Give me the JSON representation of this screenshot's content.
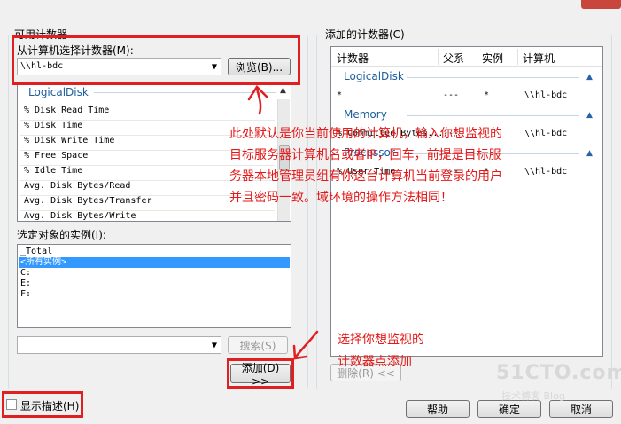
{
  "left_panel": {
    "group_title": "可用计数器",
    "select_from_label": "从计算机选择计数器(M):",
    "computer_value": "\\\\hl-bdc",
    "browse_label": "浏览(B)...",
    "category": "LogicalDisk",
    "counters": [
      "% Disk Read Time",
      "% Disk Time",
      "% Disk Write Time",
      "% Free Space",
      "% Idle Time",
      "Avg. Disk Bytes/Read",
      "Avg. Disk Bytes/Transfer",
      "Avg. Disk Bytes/Write"
    ],
    "instances_label": "选定对象的实例(I):",
    "instances": [
      "_Total",
      "<所有实例>",
      "C:",
      "E:",
      "F:"
    ],
    "selected_instance": "<所有实例>",
    "search_value": "",
    "search_label": "搜索(S)",
    "add_label": "添加(D) >>"
  },
  "right_panel": {
    "group_title": "添加的计数器(C)",
    "columns": [
      "计数器",
      "父系",
      "实例",
      "计算机"
    ],
    "groups": [
      {
        "name": "LogicalDisk",
        "row": [
          "*",
          "---",
          "*",
          "\\\\hl-bdc"
        ]
      },
      {
        "name": "Memory",
        "row": [
          "% Committed Bytes...",
          "---",
          "",
          "\\\\hl-bdc"
        ]
      },
      {
        "name": "Processor",
        "row": [
          "% User Time",
          "---",
          "*",
          "\\\\hl-bdc"
        ]
      }
    ],
    "remove_label": "删除(R) <<"
  },
  "footer": {
    "show_description_label": "显示描述(H)",
    "help_label": "帮助",
    "ok_label": "确定",
    "cancel_label": "取消"
  },
  "annotations": {
    "note1": [
      "此处默认是你当前使用的计算机，输入你想监视的",
      "目标服务器计算机名或者IP，回车，前提是目标服",
      "务器本地管理员组有你这台计算机当前登录的用户",
      "并且密码一致。域环境的操作方法相同！"
    ],
    "note2": [
      "选择你想监视的",
      "计数器点添加"
    ]
  },
  "watermark": {
    "brand": "51CTO.com",
    "sub": "技术博客  Blog"
  },
  "colors": {
    "annotation_red": "#e41818",
    "category_blue": "#1c5d9c",
    "selection_blue": "#3399ff"
  }
}
